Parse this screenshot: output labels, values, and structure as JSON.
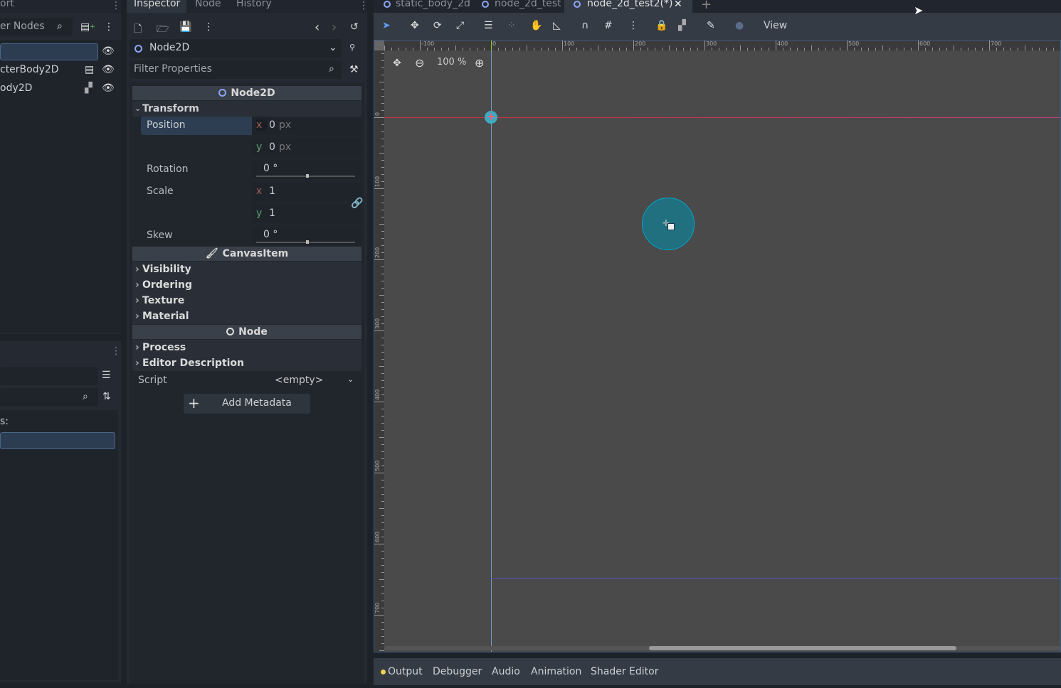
{
  "scene_dock": {
    "tab_partial": "ort",
    "filter_placeholder": "er Nodes",
    "tree": [
      {
        "label": ""
      },
      {
        "label": "cterBody2D"
      },
      {
        "label": "ody2D"
      }
    ]
  },
  "fs_dock": {
    "label_partial": "s:"
  },
  "inspector": {
    "tabs": [
      "Inspector",
      "Node",
      "History"
    ],
    "object_selector": "Node2D",
    "filter_placeholder": "Filter Properties",
    "node2d_header": "Node2D",
    "transform_group": "Transform",
    "position_label": "Position",
    "position_x": "0",
    "position_y": "0",
    "unit_px": "px",
    "rotation_label": "Rotation",
    "rotation_value": "0 °",
    "rotation_slider": 0.5,
    "scale_label": "Scale",
    "scale_x": "1",
    "scale_y": "1",
    "skew_label": "Skew",
    "skew_value": "0 °",
    "skew_slider": 0.5,
    "axis_x": "x",
    "axis_y": "y",
    "canvasitem_header": "CanvasItem",
    "canvas_groups": [
      "Visibility",
      "Ordering",
      "Texture",
      "Material"
    ],
    "node_header": "Node",
    "node_groups": [
      "Process",
      "Editor Description"
    ],
    "script_label": "Script",
    "script_value": "<empty>",
    "add_metadata": "Add Metadata"
  },
  "scene_tabs": [
    {
      "label": "static_body_2d",
      "active": false
    },
    {
      "label": "node_2d_test",
      "active": false
    },
    {
      "label": "node_2d_test2(*)",
      "active": true
    }
  ],
  "toolbar": {
    "view_label": "View"
  },
  "viewport": {
    "zoom": "100 %",
    "h_ruler": [
      "-100",
      "0",
      "100",
      "200",
      "300",
      "400",
      "500",
      "600",
      "700"
    ],
    "v_ruler": [
      "0",
      "100",
      "200",
      "300",
      "400",
      "500",
      "600",
      "700"
    ]
  },
  "bottom_tabs": [
    "Output",
    "Debugger",
    "Audio",
    "Animation",
    "Shader Editor"
  ],
  "colors": {
    "accent": "#699ce8",
    "shape": "#20707f",
    "shape_border": "#00a8d0",
    "x_axis": "#d03040",
    "y_axis": "#6fa0d0",
    "notify": "#f0d050"
  }
}
